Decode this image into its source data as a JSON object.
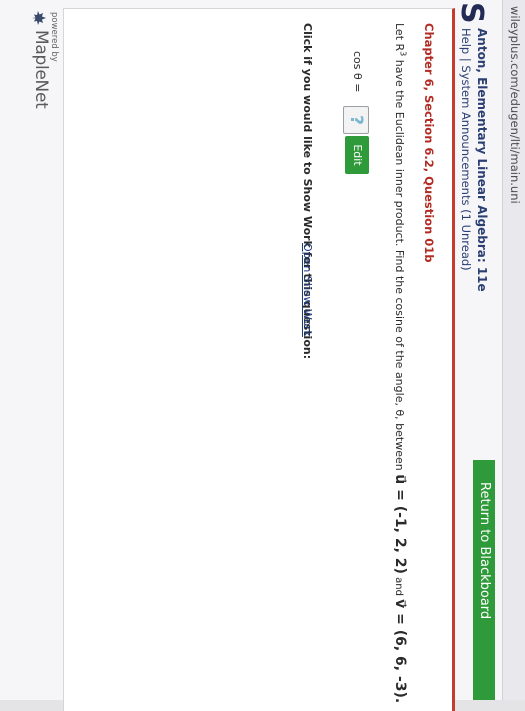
{
  "browser": {
    "url": "wileyplus.com/edugen/lti/main.uni"
  },
  "header": {
    "return_button": "Return to Blackboard",
    "logo_letter": "S",
    "course_title": "Anton, Elementary Linear Algebra: 11e",
    "links": "Help | System Announcements (1 Unread)"
  },
  "question": {
    "title": "Chapter 6, Section 6.2, Question 01b",
    "text_prefix": "Let R",
    "text_sup": "3",
    "text_main": " have the Euclidean inner product. Find the cosine of the angle, θ, between ",
    "u_vector": "u⃗ = (-1, 2, 2)",
    "and_word": " and ",
    "v_vector": "v⃗ = (6, 6, -3).",
    "answer_label": "cos θ =",
    "answer_placeholder": "?",
    "edit_button": "Edit"
  },
  "show_work": {
    "prompt": "Click if you would like to Show Work for this question:",
    "link": "Open Show Work"
  },
  "footer": {
    "powered_by": "powered by",
    "brand": "MapleNet"
  },
  "colors": {
    "accent_green": "#2f9a3a",
    "title_red": "#b12c24",
    "header_blue": "#2b3f73"
  }
}
